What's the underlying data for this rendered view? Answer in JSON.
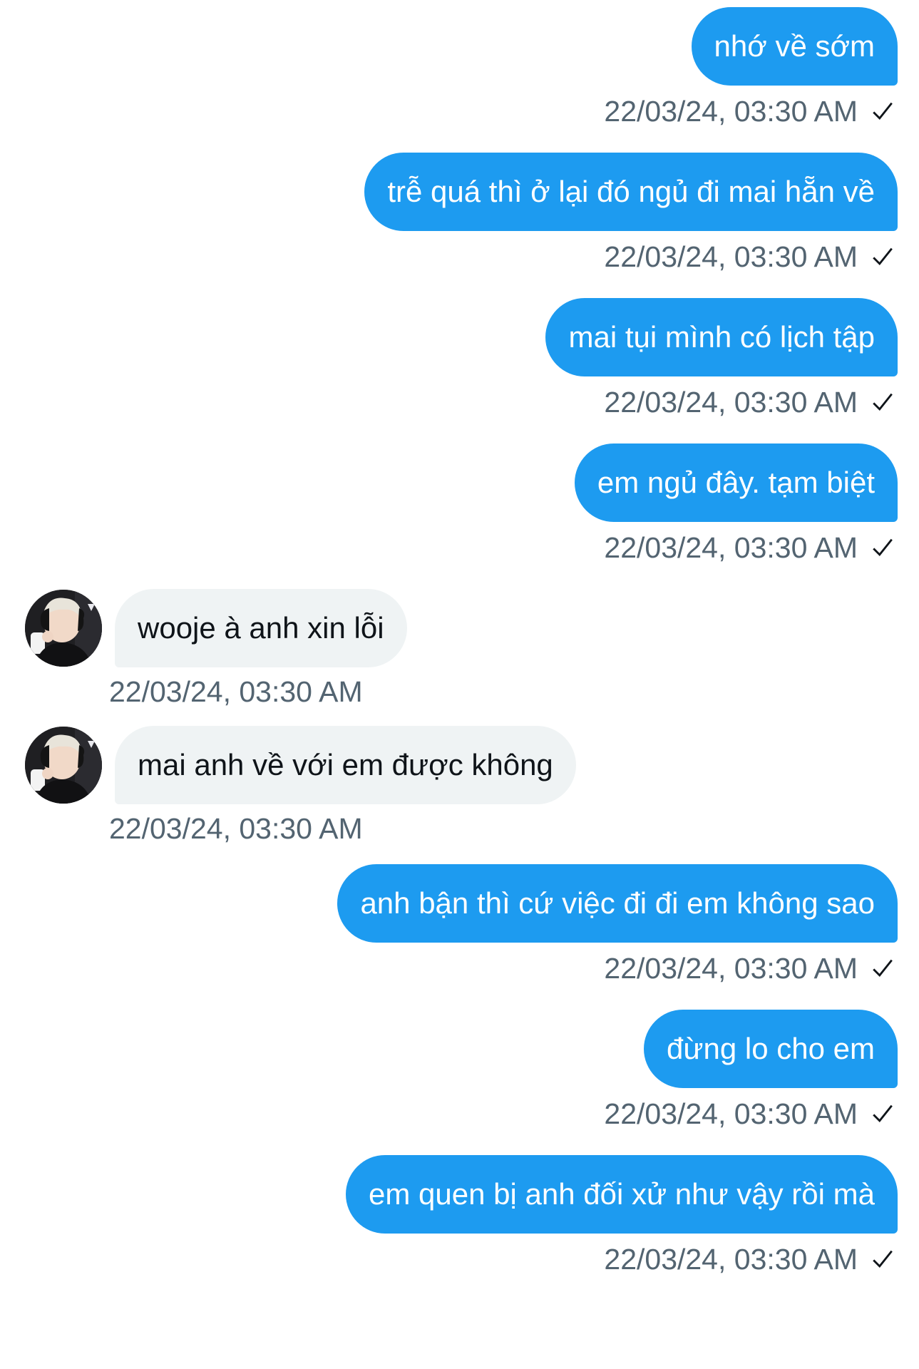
{
  "conversation": {
    "messages": [
      {
        "direction": "out",
        "text": "nhớ về sớm",
        "time": "22/03/24, 03:30 AM",
        "read_icon": "check-icon"
      },
      {
        "direction": "out",
        "text": "trễ quá thì ở lại đó ngủ đi mai hẵn về",
        "time": "22/03/24, 03:30 AM",
        "read_icon": "check-icon"
      },
      {
        "direction": "out",
        "text": "mai tụi mình có lịch tập",
        "time": "22/03/24, 03:30 AM",
        "read_icon": "check-icon"
      },
      {
        "direction": "out",
        "text": "em ngủ đây. tạm biệt",
        "time": "22/03/24, 03:30 AM",
        "read_icon": "check-icon"
      },
      {
        "direction": "in",
        "text": "wooje à anh xin lỗi",
        "time": "22/03/24, 03:30 AM",
        "avatar_icon": "user-avatar"
      },
      {
        "direction": "in",
        "text": "mai anh về với em được không",
        "time": "22/03/24, 03:30 AM",
        "avatar_icon": "user-avatar"
      },
      {
        "direction": "out",
        "text": "anh bận thì cứ việc đi đi em không sao",
        "time": "22/03/24, 03:30 AM",
        "read_icon": "check-icon"
      },
      {
        "direction": "out",
        "text": "đừng lo cho em",
        "time": "22/03/24, 03:30 AM",
        "read_icon": "check-icon"
      },
      {
        "direction": "out",
        "text": "em quen bị anh đối xử như vậy rồi mà",
        "time": "22/03/24, 03:30 AM",
        "read_icon": "check-icon"
      }
    ]
  },
  "colors": {
    "outgoing_bubble": "#1d9bf0",
    "incoming_bubble": "#eff3f4",
    "timestamp_text": "#536471"
  }
}
